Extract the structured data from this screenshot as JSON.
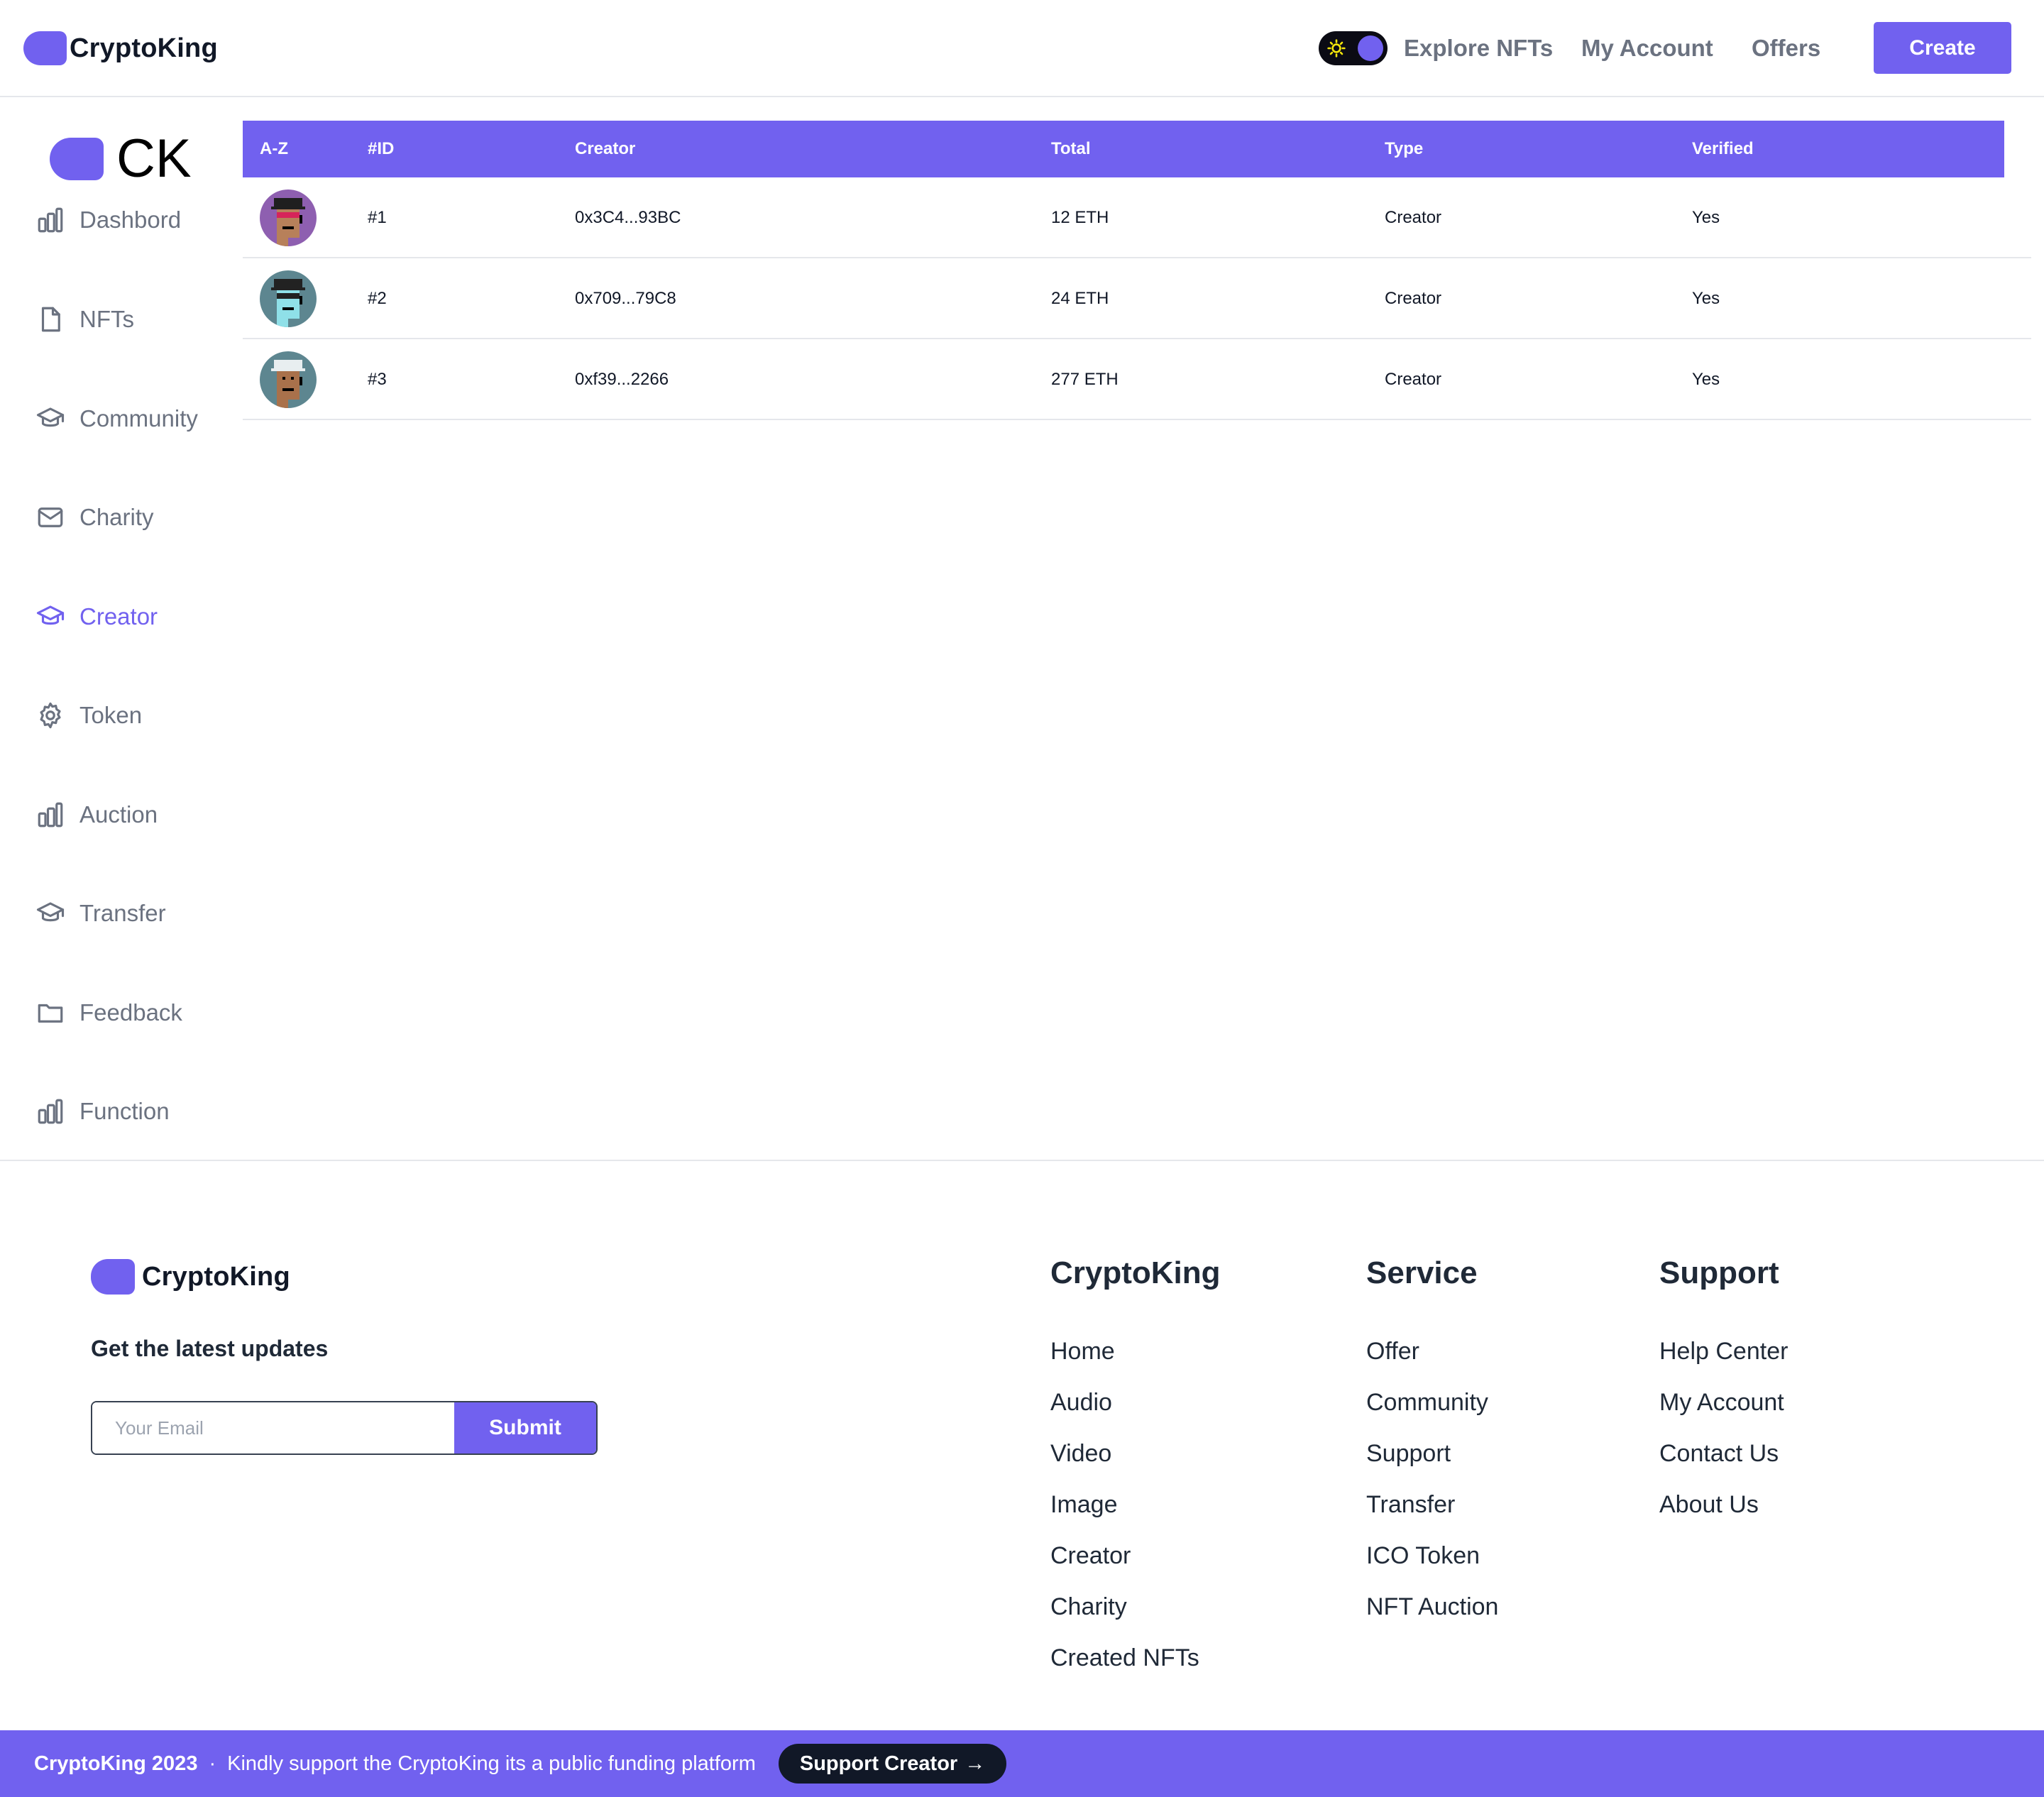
{
  "header": {
    "logo_text": "CryptoKing",
    "nav": {
      "explore": "Explore NFTs",
      "account": "My Account",
      "offers": "Offers"
    },
    "create_label": "Create"
  },
  "sidebar": {
    "logo_text": "CK",
    "items": [
      {
        "label": "Dashbord",
        "icon": "bar-chart-icon",
        "active": false
      },
      {
        "label": "NFTs",
        "icon": "document-icon",
        "active": false
      },
      {
        "label": "Community",
        "icon": "graduation-cap-icon",
        "active": false
      },
      {
        "label": "Charity",
        "icon": "mail-icon",
        "active": false
      },
      {
        "label": "Creator",
        "icon": "graduation-cap-icon",
        "active": true
      },
      {
        "label": "Token",
        "icon": "gear-icon",
        "active": false
      },
      {
        "label": "Auction",
        "icon": "bar-chart-icon",
        "active": false
      },
      {
        "label": "Transfer",
        "icon": "graduation-cap-icon",
        "active": false
      },
      {
        "label": "Feedback",
        "icon": "folder-icon",
        "active": false
      },
      {
        "label": "Function",
        "icon": "bar-chart-icon",
        "active": false
      }
    ]
  },
  "table": {
    "headers": [
      "A-Z",
      "#ID",
      "Creator",
      "Total",
      "Type",
      "Verified"
    ],
    "rows": [
      {
        "id": "#1",
        "creator": "0x3C4...93BC",
        "total": "12 ETH",
        "type": "Creator",
        "verified": "Yes"
      },
      {
        "id": "#2",
        "creator": "0x709...79C8",
        "total": "24 ETH",
        "type": "Creator",
        "verified": "Yes"
      },
      {
        "id": "#3",
        "creator": "0xf39...2266",
        "total": "277 ETH",
        "type": "Creator",
        "verified": "Yes"
      }
    ]
  },
  "footer": {
    "logo_text": "CryptoKing",
    "updates_title": "Get the latest updates",
    "email_placeholder": "Your Email",
    "submit_label": "Submit",
    "columns": [
      {
        "title": "CryptoKing",
        "links": [
          "Home",
          "Audio",
          "Video",
          "Image",
          "Creator",
          "Charity",
          "Created NFTs"
        ]
      },
      {
        "title": "Service",
        "links": [
          "Offer",
          "Community",
          "Support",
          "Transfer",
          "ICO Token",
          "NFT Auction"
        ]
      },
      {
        "title": "Support",
        "links": [
          "Help Center",
          "My Account",
          "Contact Us",
          "About Us"
        ]
      }
    ]
  },
  "bottom_bar": {
    "copyright": "CryptoKing 2023",
    "separator": "·",
    "message": "Kindly support the CryptoKing its a public funding platform",
    "button_label": "Support Creator",
    "button_arrow": "→"
  },
  "colors": {
    "accent": "#7161ef",
    "dark": "#111827",
    "muted": "#6b7280"
  }
}
